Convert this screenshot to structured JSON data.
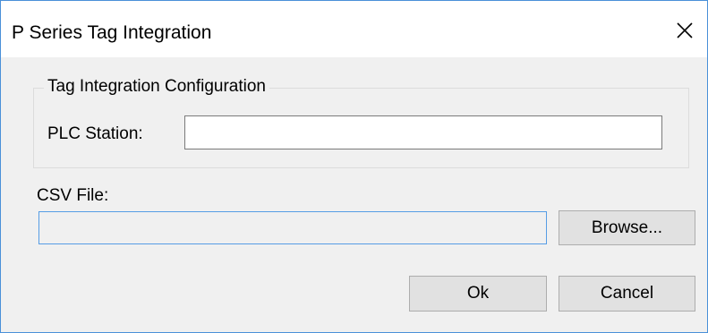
{
  "window": {
    "title": "P Series Tag Integration"
  },
  "group": {
    "legend": "Tag Integration Configuration",
    "plc_station_label": "PLC Station:",
    "plc_station_value": ""
  },
  "csv": {
    "label": "CSV File:",
    "value": "",
    "browse_label": "Browse..."
  },
  "actions": {
    "ok_label": "Ok",
    "cancel_label": "Cancel"
  },
  "icons": {
    "close": "close-icon"
  }
}
